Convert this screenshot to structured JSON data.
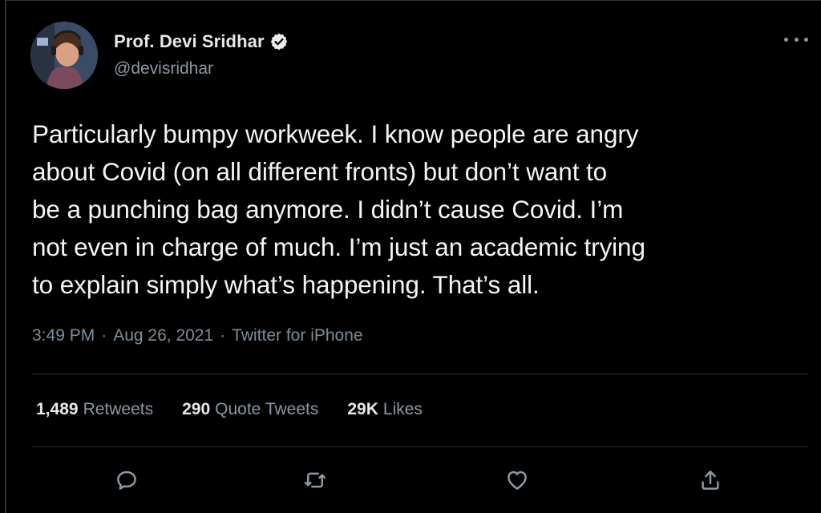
{
  "author": {
    "display_name": "Prof. Devi Sridhar",
    "handle": "@devisridhar",
    "verified": true
  },
  "tweet": {
    "text": "Particularly bumpy workweek. I know people are angry\nabout Covid (on all different fronts) but don’t want to\nbe a punching bag anymore. I didn’t cause Covid. I’m\nnot even in charge of much. I’m just an academic trying\nto explain simply what’s happening. That’s all.",
    "time": "3:49 PM",
    "date": "Aug 26, 2021",
    "source": "Twitter for iPhone",
    "separator": "·"
  },
  "stats": {
    "retweets": {
      "count": "1,489",
      "label": "Retweets"
    },
    "quotes": {
      "count": "290",
      "label": "Quote Tweets"
    },
    "likes": {
      "count": "29K",
      "label": "Likes"
    }
  },
  "actions": {
    "reply": "reply-icon",
    "retweet": "retweet-icon",
    "like": "heart-icon",
    "share": "share-icon"
  },
  "colors": {
    "background": "#000000",
    "text_primary": "#e7e9ea",
    "text_secondary": "#8b98a5",
    "divider": "#2f3336",
    "verified_badge": "#e7e9ea"
  }
}
